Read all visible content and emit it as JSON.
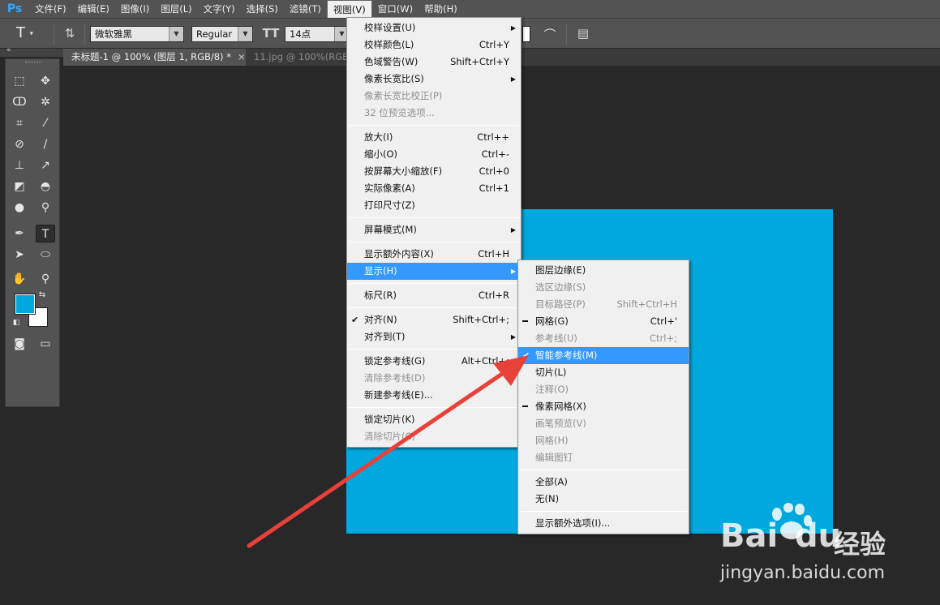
{
  "app": {
    "logo": "Ps"
  },
  "menubar": {
    "items": [
      "文件(F)",
      "编辑(E)",
      "图像(I)",
      "图层(L)",
      "文字(Y)",
      "选择(S)",
      "滤镜(T)",
      "视图(V)",
      "窗口(W)",
      "帮助(H)"
    ],
    "active_index": 7
  },
  "options_bar": {
    "tool_preset_icon": "type-tool-icon",
    "font_family": "微软雅黑",
    "font_style": "Regular",
    "font_size": "14点"
  },
  "tabs": [
    {
      "label": "未标题-1 @ 100% (图层 1, RGB/8) *",
      "close": "×",
      "active": true
    },
    {
      "label": "11.jpg @ 100%(RGB/",
      "active": false
    }
  ],
  "colors": {
    "foreground": "#00a8dd",
    "background": "#ffffff",
    "canvas": "#00a8dd",
    "menu_highlight": "#3399ff",
    "arrow": "#e8413a"
  },
  "view_menu": {
    "groups": [
      [
        {
          "label": "校样设置(U)",
          "submenu": true
        },
        {
          "label": "校样颜色(L)",
          "shortcut": "Ctrl+Y"
        },
        {
          "label": "色域警告(W)",
          "shortcut": "Shift+Ctrl+Y"
        },
        {
          "label": "像素长宽比(S)",
          "submenu": true
        },
        {
          "label": "像素长宽比校正(P)",
          "disabled": true
        },
        {
          "label": "32 位预览选项...",
          "disabled": true
        }
      ],
      [
        {
          "label": "放大(I)",
          "shortcut": "Ctrl++"
        },
        {
          "label": "缩小(O)",
          "shortcut": "Ctrl+-"
        },
        {
          "label": "按屏幕大小缩放(F)",
          "shortcut": "Ctrl+0"
        },
        {
          "label": "实际像素(A)",
          "shortcut": "Ctrl+1"
        },
        {
          "label": "打印尺寸(Z)"
        }
      ],
      [
        {
          "label": "屏幕模式(M)",
          "submenu": true
        }
      ],
      [
        {
          "label": "显示额外内容(X)",
          "shortcut": "Ctrl+H"
        },
        {
          "label": "显示(H)",
          "submenu": true,
          "highlighted": true
        }
      ],
      [
        {
          "label": "标尺(R)",
          "shortcut": "Ctrl+R"
        }
      ],
      [
        {
          "label": "对齐(N)",
          "shortcut": "Shift+Ctrl+;",
          "checked": true
        },
        {
          "label": "对齐到(T)",
          "submenu": true
        }
      ],
      [
        {
          "label": "锁定参考线(G)",
          "shortcut": "Alt+Ctrl+;"
        },
        {
          "label": "清除参考线(D)",
          "disabled": true
        },
        {
          "label": "新建参考线(E)..."
        }
      ],
      [
        {
          "label": "锁定切片(K)"
        },
        {
          "label": "清除切片(C)",
          "disabled": true
        }
      ]
    ]
  },
  "show_submenu": {
    "groups": [
      [
        {
          "label": "图层边缘(E)"
        },
        {
          "label": "选区边缘(S)",
          "disabled": true
        },
        {
          "label": "目标路径(P)",
          "shortcut": "Shift+Ctrl+H",
          "disabled": true
        },
        {
          "label": "网格(G)",
          "shortcut": "Ctrl+'",
          "dash": true
        },
        {
          "label": "参考线(U)",
          "shortcut": "Ctrl+;",
          "disabled": true
        },
        {
          "label": "智能参考线(M)",
          "checked": true,
          "highlighted": true
        },
        {
          "label": "切片(L)"
        },
        {
          "label": "注释(O)",
          "disabled": true
        },
        {
          "label": "像素网格(X)",
          "dash": true
        },
        {
          "label": "画笔预览(V)",
          "disabled": true
        },
        {
          "label": "网格(H)",
          "disabled": true
        },
        {
          "label": "编辑图钉",
          "disabled": true
        }
      ],
      [
        {
          "label": "全部(A)"
        },
        {
          "label": "无(N)"
        }
      ],
      [
        {
          "label": "显示额外选项(I)..."
        }
      ]
    ]
  },
  "watermark": {
    "brand": "Bai",
    "brand_du": "du",
    "suffix": "经验",
    "url": "jingyan.baidu.com"
  }
}
